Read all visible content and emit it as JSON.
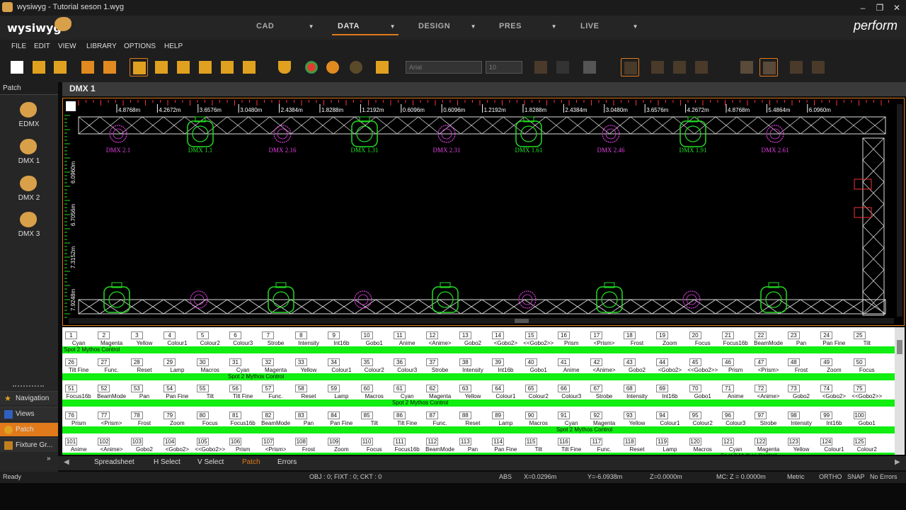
{
  "window": {
    "title": "wysiwyg - Tutorial seson 1.wyg"
  },
  "app": {
    "logo": "wysiwyg",
    "product": "perform"
  },
  "modes": [
    {
      "label": "CAD"
    },
    {
      "label": "DATA"
    },
    {
      "label": "DESIGN"
    },
    {
      "label": "PRES"
    },
    {
      "label": "LIVE"
    }
  ],
  "menu": [
    "FILE",
    "EDIT",
    "VIEW",
    "LIBRARY",
    "OPTIONS",
    "HELP"
  ],
  "toolbar": {
    "font": "Arial",
    "size": "10"
  },
  "patch": {
    "header": "Patch",
    "items": [
      "EDMX",
      "DMX 1",
      "DMX 2",
      "DMX 3"
    ]
  },
  "nav": [
    {
      "label": "Navigation"
    },
    {
      "label": "Views"
    },
    {
      "label": "Patch"
    },
    {
      "label": "Fixture Gr..."
    }
  ],
  "main": {
    "title": "DMX 1"
  },
  "ruler": [
    "4.8768m",
    "4.2672m",
    "3.6576m",
    "3.0480m",
    "2.4384m",
    "1.8288m",
    "1.2192m",
    "0.6096m",
    "0.6096m",
    "1.2192m",
    "1.8288m",
    "2.4384m",
    "3.0480m",
    "3.6576m",
    "4.2672m",
    "4.8768m",
    "5.4864m",
    "6.0960m"
  ],
  "vruler": [
    "6.0960m",
    "6.7056m",
    "7.3152m",
    "7.9248m"
  ],
  "fixtures": [
    {
      "label": "DMX 2.1",
      "color": "#e040e0"
    },
    {
      "label": "DMX 1.1",
      "color": "#22dd22"
    },
    {
      "label": "DMX 2.16",
      "color": "#e040e0"
    },
    {
      "label": "DMX 1.31",
      "color": "#22dd22"
    },
    {
      "label": "DMX 2.31",
      "color": "#e040e0"
    },
    {
      "label": "DMX 1.61",
      "color": "#22dd22"
    },
    {
      "label": "DMX 2.46",
      "color": "#e040e0"
    },
    {
      "label": "DMX 1.91",
      "color": "#22dd22"
    },
    {
      "label": "DMX 2.61",
      "color": "#e040e0"
    }
  ],
  "patchgrid": {
    "spot": "Spot 2  Mythos Control",
    "rows": [
      [
        "Cyan",
        "Magenta",
        "Yellow",
        "Colour1",
        "Colour2",
        "Colour3",
        "Strobe",
        "Intensity",
        "Int16b",
        "Gobo1",
        "Anime",
        "<Anime>",
        "Gobo2",
        "<Gobo2>",
        "<<Gobo2>>",
        "Prism",
        "<Prism>",
        "Frost",
        "Zoom",
        "Focus",
        "Focus16b",
        "BeamMode",
        "Pan",
        "Pan Fine",
        "Tilt"
      ],
      [
        "Tilt Fine",
        "Func.",
        "Reset",
        "Lamp",
        "Macros",
        "Cyan",
        "Magenta",
        "Yellow",
        "Colour1",
        "Colour2",
        "Colour3",
        "Strobe",
        "Intensity",
        "Int16b",
        "Gobo1",
        "Anime",
        "<Anime>",
        "Gobo2",
        "<Gobo2>",
        "<<Gobo2>>",
        "Prism",
        "<Prism>",
        "Frost",
        "Zoom",
        "Focus"
      ],
      [
        "Focus16b",
        "BeamMode",
        "Pan",
        "Pan Fine",
        "Tilt",
        "Tilt Fine",
        "Func.",
        "Reset",
        "Lamp",
        "Macros",
        "Cyan",
        "Magenta",
        "Yellow",
        "Colour1",
        "Colour2",
        "Colour3",
        "Strobe",
        "Intensity",
        "Int16b",
        "Gobo1",
        "Anime",
        "<Anime>",
        "Gobo2",
        "<Gobo2>",
        "<<Gobo2>>"
      ],
      [
        "Prism",
        "<Prism>",
        "Frost",
        "Zoom",
        "Focus",
        "Focus16b",
        "BeamMode",
        "Pan",
        "Pan Fine",
        "Tilt",
        "Tilt Fine",
        "Func.",
        "Reset",
        "Lamp",
        "Macros",
        "Cyan",
        "Magenta",
        "Yellow",
        "Colour1",
        "Colour2",
        "Colour3",
        "Strobe",
        "Intensity",
        "Int16b",
        "Gobo1"
      ],
      [
        "Anime",
        "<Anime>",
        "Gobo2",
        "<Gobo2>",
        "<<Gobo2>>",
        "Prism",
        "<Prism>",
        "Frost",
        "Zoom",
        "Focus",
        "Focus16b",
        "BeamMode",
        "Pan",
        "Pan Fine",
        "Tilt",
        "Tilt Fine",
        "Func.",
        "Reset",
        "Lamp",
        "Macros",
        "Cyan",
        "Magenta",
        "Yellow",
        "Colour1",
        "Colour2"
      ]
    ]
  },
  "tabs": [
    {
      "label": "Spreadsheet"
    },
    {
      "label": "H Select"
    },
    {
      "label": "V Select"
    },
    {
      "label": "Patch"
    },
    {
      "label": "Errors"
    }
  ],
  "status": {
    "ready": "Ready",
    "obj": "OBJ : 0;  FIXT : 0;  CKT : 0",
    "abs": "ABS",
    "x": "X=0.0296m",
    "y": "Y=-6.0938m",
    "z": "Z=0.0000m",
    "mc": "MC: Z = 0.0000m",
    "metric": "Metric",
    "ortho": "ORTHO",
    "snap": "SNAP",
    "errors": "No Errors"
  },
  "colors": {
    "accent": "#e07a1a",
    "green": "#22dd22",
    "magenta": "#e040e0",
    "ruler_red": "#ff3030"
  }
}
